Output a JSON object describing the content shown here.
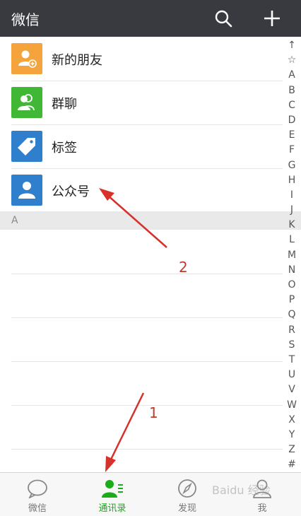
{
  "header": {
    "title": "微信"
  },
  "contacts_menu": [
    {
      "label": "新的朋友",
      "color": "#f5a33c",
      "icon": "person-add-icon"
    },
    {
      "label": "群聊",
      "color": "#40b835",
      "icon": "group-icon"
    },
    {
      "label": "标签",
      "color": "#2f7fcc",
      "icon": "tag-icon"
    },
    {
      "label": "公众号",
      "color": "#2f7fcc",
      "icon": "person-icon"
    }
  ],
  "section_header": "A",
  "index_letters": [
    "↑",
    "☆",
    "A",
    "B",
    "C",
    "D",
    "E",
    "F",
    "G",
    "H",
    "I",
    "J",
    "K",
    "L",
    "M",
    "N",
    "O",
    "P",
    "Q",
    "R",
    "S",
    "T",
    "U",
    "V",
    "W",
    "X",
    "Y",
    "Z",
    "#"
  ],
  "tabs": [
    {
      "label": "微信",
      "icon": "chat-bubble-icon",
      "active": false
    },
    {
      "label": "通讯录",
      "icon": "contacts-icon",
      "active": true
    },
    {
      "label": "发现",
      "icon": "compass-icon",
      "active": false
    },
    {
      "label": "我",
      "icon": "me-icon",
      "active": false
    }
  ],
  "annotations": {
    "one": "1",
    "two": "2"
  },
  "watermark": "Baidu 经验",
  "colors": {
    "topbar": "#393a3f",
    "accent": "#1aad19",
    "annotation": "#c0392b"
  }
}
